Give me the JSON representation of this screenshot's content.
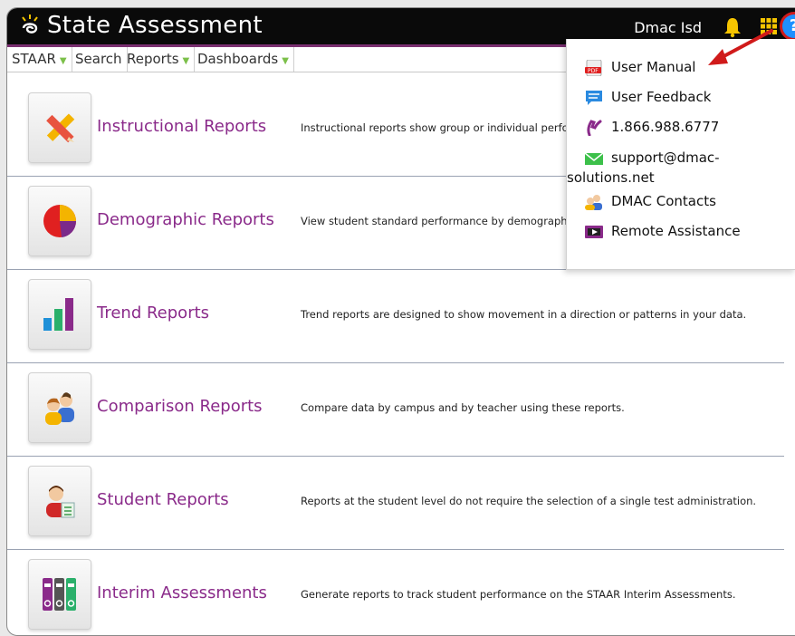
{
  "header": {
    "title": "State Assessment",
    "user": "Dmac Isd"
  },
  "menu": {
    "staar": "STAAR",
    "search": "Search",
    "reports": "Reports",
    "dashboards": "Dashboards"
  },
  "rows": [
    {
      "title": "Instructional Reports",
      "description": "Instructional reports show group or individual performan",
      "icon": "pencil-ruler-icon"
    },
    {
      "title": "Demographic Reports",
      "description": "View student standard performance by demographic grou",
      "icon": "pie-chart-icon"
    },
    {
      "title": "Trend Reports",
      "description": "Trend reports are designed to show movement in a direction or patterns in your data.",
      "icon": "bar-chart-icon"
    },
    {
      "title": "Comparison Reports",
      "description": "Compare data by campus and by teacher using these reports.",
      "icon": "people-icon"
    },
    {
      "title": "Student Reports",
      "description": "Reports at the student level do not require the selection of a single test administration.",
      "icon": "student-icon"
    },
    {
      "title": "Interim Assessments",
      "description": "Generate reports to track student performance on the STAAR Interim Assessments.",
      "icon": "binders-icon"
    }
  ],
  "help_menu": {
    "user_manual": "User Manual",
    "user_feedback": "User Feedback",
    "phone": "1.866.988.6777",
    "email_line1": "support@dmac-",
    "email_line2": "solutions.net",
    "contacts": "DMAC Contacts",
    "remote": "Remote Assistance"
  },
  "colors": {
    "accent_purple": "#8a2a8a",
    "menu_chevron": "#7cc04a",
    "annotation_red": "#d01a1a",
    "help_blue": "#1e90ff"
  }
}
